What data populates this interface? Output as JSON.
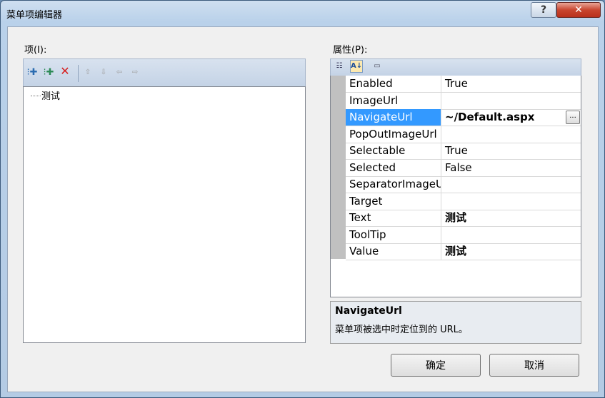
{
  "window": {
    "title": "菜单项编辑器",
    "help_label": "?",
    "close_label": "✕"
  },
  "items_panel": {
    "label": "项(I):",
    "toolbar": [
      "add-root-item-icon",
      "add-child-item-icon",
      "delete-item-icon",
      "move-up-icon",
      "move-down-icon",
      "outdent-icon",
      "indent-icon"
    ],
    "tree_items": [
      "测试"
    ]
  },
  "properties_panel": {
    "label": "属性(P):",
    "properties": [
      {
        "name": "Enabled",
        "value": "True",
        "bold": false
      },
      {
        "name": "ImageUrl",
        "value": "",
        "bold": false
      },
      {
        "name": "NavigateUrl",
        "value": "~/Default.aspx",
        "bold": true,
        "selected": true
      },
      {
        "name": "PopOutImageUrl",
        "value": "",
        "bold": false
      },
      {
        "name": "Selectable",
        "value": "True",
        "bold": false
      },
      {
        "name": "Selected",
        "value": "False",
        "bold": false
      },
      {
        "name": "SeparatorImageUrl",
        "value": "",
        "bold": false
      },
      {
        "name": "Target",
        "value": "",
        "bold": false
      },
      {
        "name": "Text",
        "value": "测试",
        "bold": true
      },
      {
        "name": "ToolTip",
        "value": "",
        "bold": false
      },
      {
        "name": "Value",
        "value": "测试",
        "bold": true
      }
    ],
    "ellipsis_label": "...",
    "description": {
      "title": "NavigateUrl",
      "text": "菜单项被选中时定位到的 URL。"
    }
  },
  "buttons": {
    "ok": "确定",
    "cancel": "取消"
  },
  "colors": {
    "selection": "#3399ff",
    "titlebar": "#b9d1ea",
    "close": "#c8452f"
  }
}
